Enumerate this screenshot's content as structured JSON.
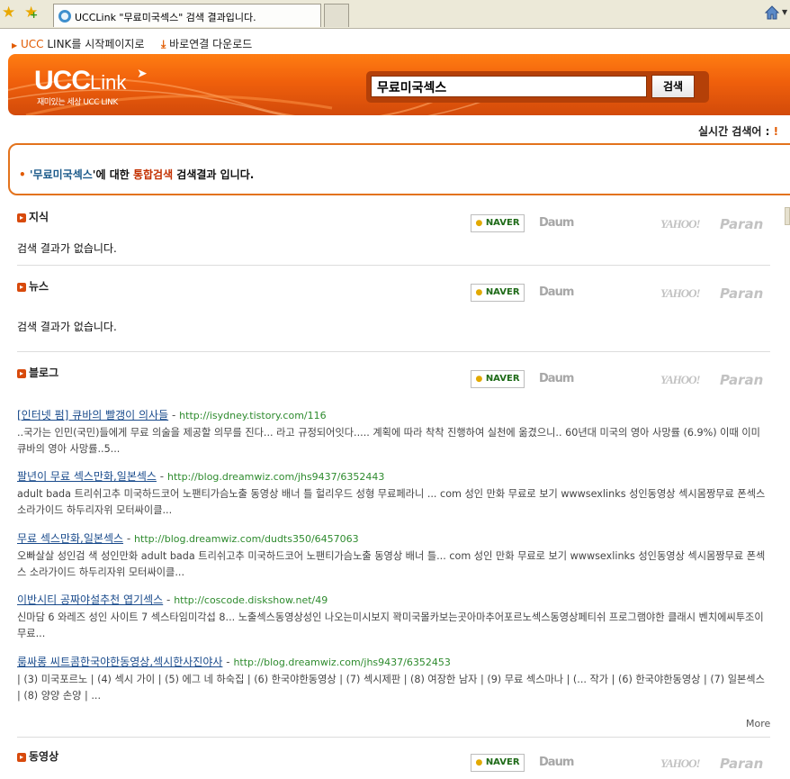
{
  "browser": {
    "tab_title": "UCCLink \"무료미국섹스\" 검색 결과입니다."
  },
  "topbar": {
    "home_prefix": "UCC",
    "home_link": " LINK를 시작페이지로",
    "download_link": "바로연결 다운로드"
  },
  "header": {
    "logo_ucc": "UCC",
    "logo_link": "Link",
    "slogan": "재미있는 세상 UCC LINK",
    "search_value": "무료미국섹스",
    "search_button": "검색"
  },
  "realtime": {
    "label": "실시간 검색어 :"
  },
  "summary": {
    "bullet": "•",
    "prefix": "'",
    "query": "무료미국섹스",
    "mid": "'에 대한 ",
    "highlight": "통합검색",
    "suffix": " 검색결과 입니다."
  },
  "engines": {
    "naver": "NAVER",
    "daum": "Daum",
    "yahoo": "YAHOO!",
    "paran": "Paran"
  },
  "sections": [
    {
      "label": "지식",
      "empty": "검색 결과가 없습니다."
    },
    {
      "label": "뉴스",
      "empty": "검색 결과가 없습니다."
    },
    {
      "label": "블로그"
    },
    {
      "label": "동영상"
    }
  ],
  "blog_results": [
    {
      "title": "[인터넷 펌] 큐바의 빨갱이 의사들",
      "url": "http://isydney.tistory.com/116",
      "desc": "..국가는 인민(국민)들에게 무료 의술을 제공할 의무를 진다... 라고 규정되어잇다..... 계획에 따라 착착 진행하여 실천에 옮겼으니.. 60년대 미국의 영아 사망률 (6.9%) 이때 이미 큐바의 영아 사망률..5..."
    },
    {
      "title": "팔년이 무료 섹스만화,일본섹스",
      "url": "http://blog.dreamwiz.com/jhs9437/6352443",
      "desc": "adult bada 트리쉬고추 미국하드코어 노팬티가슴노출 동영상 배너 틀 헐리우드 성형 무료페라니 ... com 성인 만화 무료로 보기 wwwsexlinks 성인동영상 섹시몸짱무료 폰섹스 소라가이드 하두리자위 모터싸이클..."
    },
    {
      "title": "무료 섹스만화,일본섹스",
      "url": "http://blog.dreamwiz.com/dudts350/6457063",
      "desc": "오빠살살 성인검 색 성인만화 adult bada 트리쉬고추 미국하드코어 노팬티가슴노출 동영상 배너 틀... com 성인 만화 무료로 보기 wwwsexlinks 성인동영상 섹시몸짱무료 폰섹스 소라가이드 하두리자위 모터싸이클..."
    },
    {
      "title": "이반시티 공짜야설추천 엽기섹스",
      "url": "http://coscode.diskshow.net/49",
      "desc": "신마담 6 와레즈 성인 사이트 7 섹스타임미각섭 8... 노출섹스동영상성인 나오는미시보지 꽉미국몰카보는곳아마추어포르노섹스동영상페티쉬 프로그램야한 클래시 벤치에씨투조이무료..."
    },
    {
      "title": "룸싸롱 씨트콤한국야한동영상,섹시한사진야사",
      "url": "http://blog.dreamwiz.com/jhs9437/6352453",
      "desc": "| (3) 미국포르노 | (4) 섹시 가이 | (5) 에그 네 하숙집 | (6) 한국야한동영상 | (7) 섹시제판 | (8) 여장한 남자 | (9) 무료 섹스마나 | (... 작가 | (6) 한국야한동영상 | (7) 일본섹스 | (8) 양양 손양 | ..."
    }
  ],
  "more_label": "More"
}
